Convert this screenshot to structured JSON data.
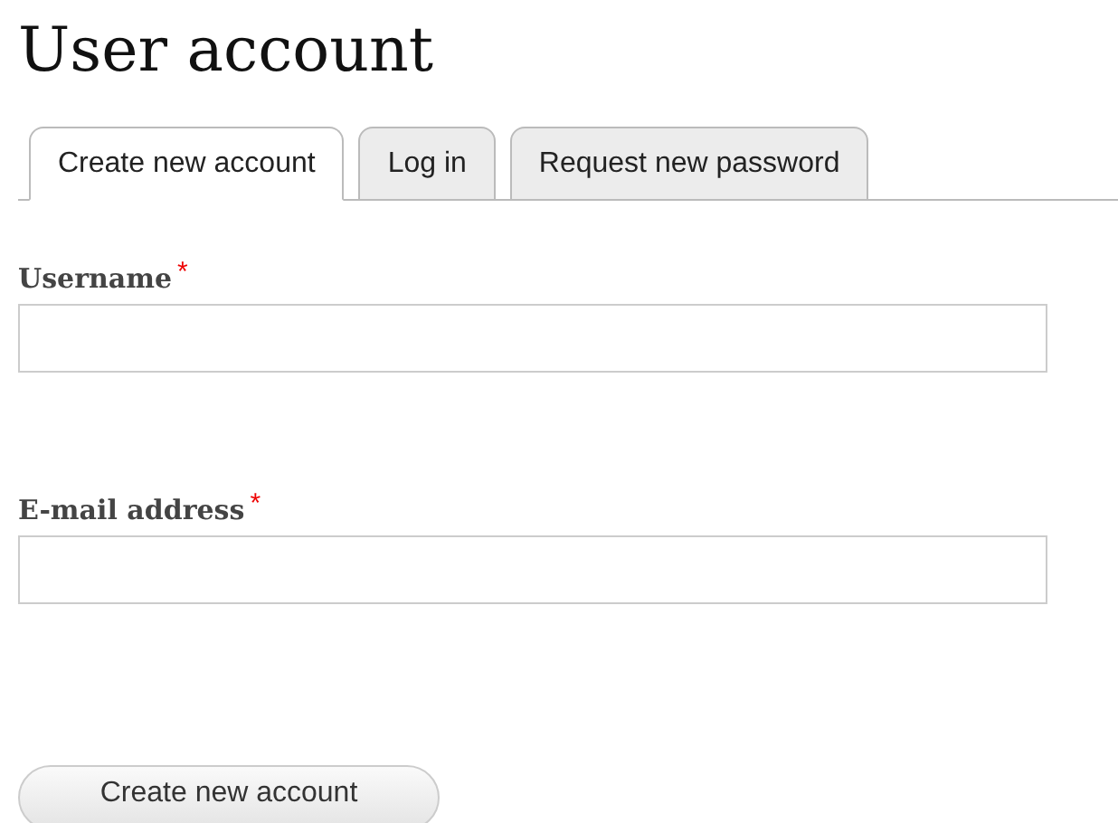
{
  "title": "User account",
  "tabs": [
    {
      "label": "Create new account",
      "selected": true
    },
    {
      "label": "Log in",
      "selected": false
    },
    {
      "label": "Request new password",
      "selected": false
    }
  ],
  "fields": [
    {
      "label": "Username",
      "required_mark": "*"
    },
    {
      "label": "E-mail address",
      "required_mark": "*"
    }
  ],
  "submit_button": "Create new account"
}
